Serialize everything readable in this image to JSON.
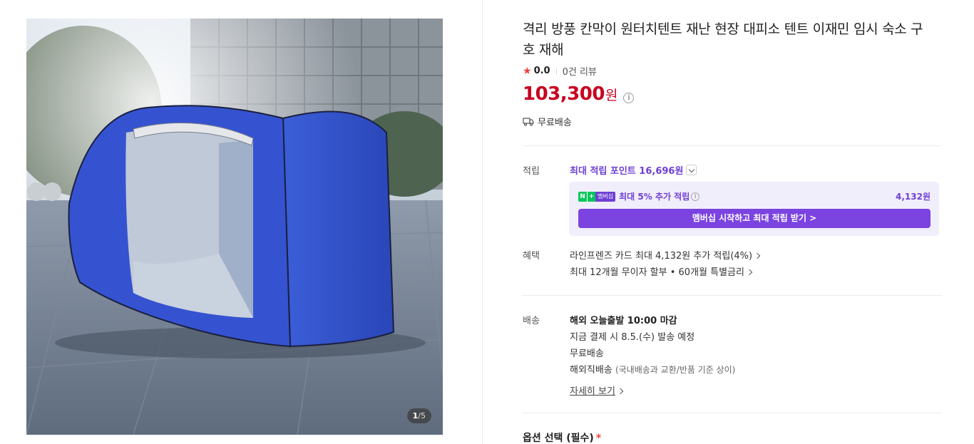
{
  "gallery": {
    "current": "1",
    "total": "/5",
    "image_icon": "tent-photo"
  },
  "product": {
    "title": "격리 방풍 칸막이 원터치텐트 재난 현장 대피소 텐트 이재민 임시 숙소 구호 재해",
    "rating": "0.0",
    "reviews": "0건 리뷰",
    "price": "103,300",
    "price_unit": "원",
    "shipping_short": "무료배송"
  },
  "points": {
    "label": "적립",
    "max_points_text": "최대 적립 포인트 16,696원",
    "membership_badge": "멤버십",
    "membership_extra": "최대 5% 추가 적립",
    "membership_amount": "4,132원",
    "membership_button": "멤버십 시작하고 최대 적립 받기 >"
  },
  "benefits": {
    "label": "혜택",
    "card": "라인프렌즈 카드 최대 4,132원 추가 적립(4%)",
    "installment": "최대 12개월 무이자 할부 • 60개월 특별금리"
  },
  "delivery": {
    "label": "배송",
    "departure": "해외 오늘출발 10:00 마감",
    "schedule": "지금 결제 시 8.5.(수) 발송 예정",
    "fee": "무료배송",
    "type": "해외직배송",
    "type_note": "(국내배송과 교환/반품 기준 상이)",
    "more": "자세히 보기"
  },
  "options": {
    "title": "옵션 선택 (필수)",
    "required_mark": "*"
  },
  "colors": {
    "price": "#c8001f",
    "accent": "#6e3fd5",
    "star": "#f43e3e"
  }
}
